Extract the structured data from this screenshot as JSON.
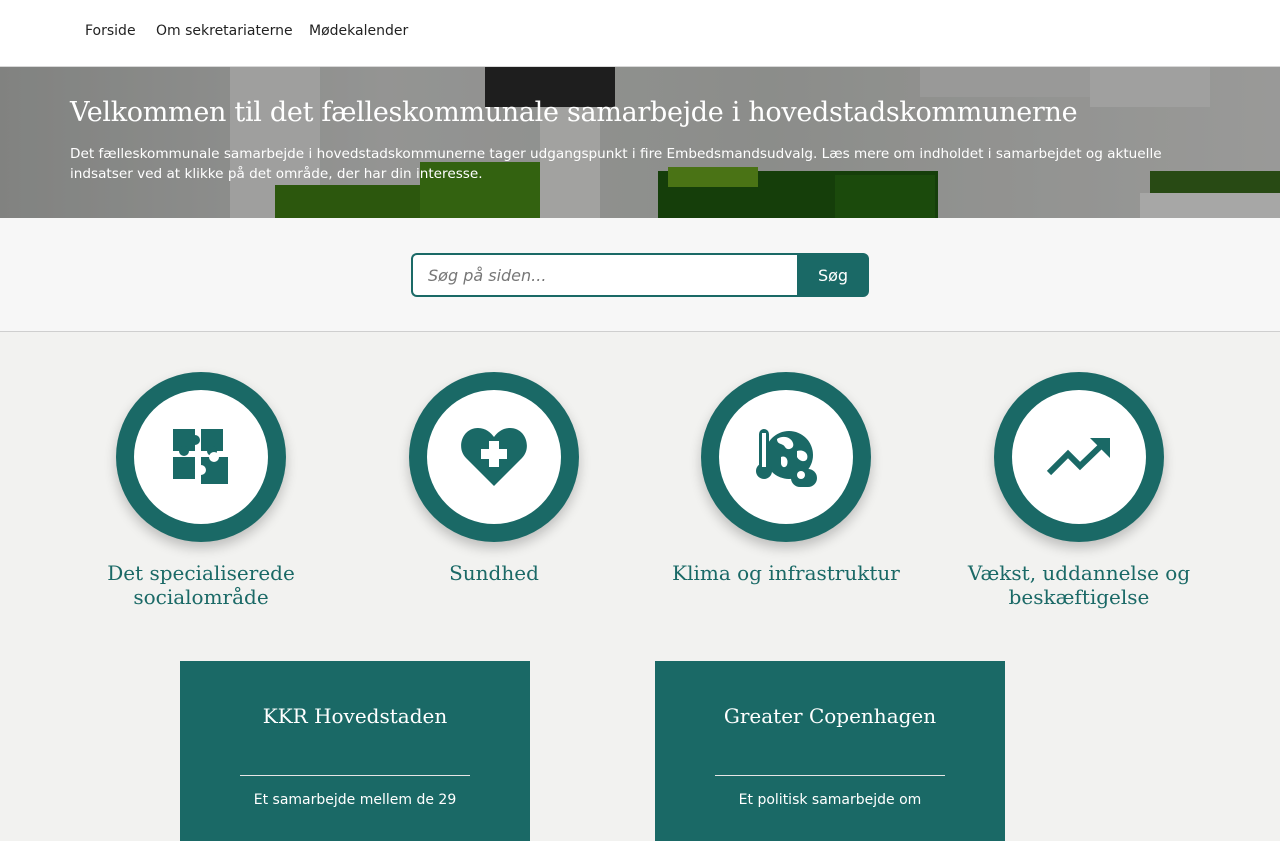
{
  "nav": {
    "items": [
      {
        "label": "Forside"
      },
      {
        "label": "Om sekretariaterne"
      },
      {
        "label": "Mødekalender"
      }
    ]
  },
  "hero": {
    "title": "Velkommen til det fælleskommunale samarbejde i hovedstadskommunerne",
    "text": "Det fælleskommunale samarbejde i hovedstadskommunerne tager udgangspunkt i fire Embedsmandsudvalg. Læs mere om indholdet i samarbejdet og aktuelle indsatser ved at klikke på det område, der har din interesse."
  },
  "search": {
    "placeholder": "Søg på siden...",
    "button_label": "Søg"
  },
  "categories": [
    {
      "label": "Det specialiserede socialområde",
      "icon": "puzzle-icon"
    },
    {
      "label": "Sundhed",
      "icon": "heart-plus-icon"
    },
    {
      "label": "Klima og infrastruktur",
      "icon": "globe-climate-icon"
    },
    {
      "label": "Vækst, uddannelse og beskæftigelse",
      "icon": "trend-up-icon"
    }
  ],
  "cards": [
    {
      "title": "KKR Hovedstaden",
      "text": "Et samarbejde mellem de 29"
    },
    {
      "title": "Greater Copenhagen",
      "text": "Et politisk samarbejde om"
    }
  ],
  "colors": {
    "accent": "#1a6966",
    "nav_bg": "#ffffff",
    "page_bg": "#f2f2f0"
  }
}
